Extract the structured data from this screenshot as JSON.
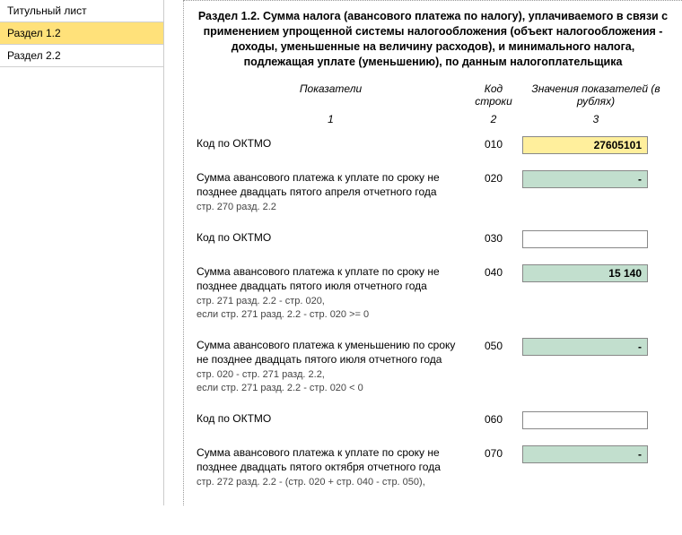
{
  "sidebar": {
    "items": [
      {
        "label": "Титульный лист"
      },
      {
        "label": "Раздел 1.2"
      },
      {
        "label": "Раздел 2.2"
      }
    ],
    "active_index": 1
  },
  "header": {
    "title": "Раздел 1.2. Сумма налога (авансового платежа по налогу), уплачиваемого в связи с применением упрощенной системы налогообложения (объект налогообложения - доходы, уменьшенные на величину расходов), и минимального налога, подлежащая уплате (уменьшению), по данным налогоплательщика"
  },
  "columns": {
    "indicator": "Показатели",
    "code": "Код строки",
    "value": "Значения показателей (в рублях)",
    "n1": "1",
    "n2": "2",
    "n3": "3"
  },
  "rows": [
    {
      "label": "Код по ОКТМО",
      "note": "",
      "code": "010",
      "value": "27605101",
      "style": "yellow"
    },
    {
      "label": "Сумма авансового платежа к уплате по сроку не позднее двадцать пятого апреля отчетного года",
      "note": "стр. 270 разд. 2.2",
      "code": "020",
      "value": "-",
      "style": "green"
    },
    {
      "label": "Код по ОКТМО",
      "note": "",
      "code": "030",
      "value": "",
      "style": "white"
    },
    {
      "label": "Сумма  авансового платежа к уплате по сроку не позднее двадцать пятого июля отчетного года",
      "note": "стр. 271 разд. 2.2 - стр. 020,\nесли стр. 271 разд. 2.2 - стр. 020 >= 0",
      "code": "040",
      "value": "15 140",
      "style": "green"
    },
    {
      "label": "Сумма авансового платежа к уменьшению по сроку не позднее двадцать пятого июля отчетного года",
      "note": "стр. 020 - стр. 271 разд. 2.2,\nесли стр. 271 разд. 2.2 - стр. 020 < 0",
      "code": "050",
      "value": "-",
      "style": "green"
    },
    {
      "label": "Код по ОКТМО",
      "note": "",
      "code": "060",
      "value": "",
      "style": "white"
    },
    {
      "label": "Сумма авансового платежа к уплате по сроку не позднее двадцать пятого октября отчетного года",
      "note": "стр. 272 разд. 2.2 - (стр. 020 + стр. 040 - стр. 050),",
      "code": "070",
      "value": "-",
      "style": "green"
    }
  ]
}
